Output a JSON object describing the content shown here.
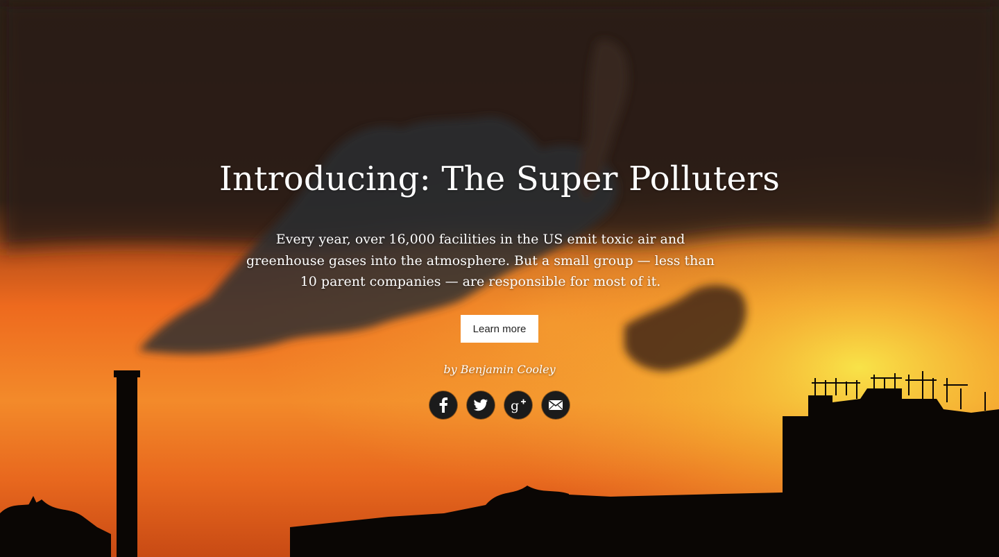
{
  "hero": {
    "title": "Introducing: The Super Polluters",
    "lede": "Every year, over 16,000 facilities in the US emit toxic air and greenhouse gases into the atmosphere. But a small group — less than 10 parent companies — are responsible for most of it.",
    "button_label": "Learn more",
    "byline": "by Benjamin Cooley"
  },
  "share": [
    {
      "icon": "facebook-icon"
    },
    {
      "icon": "twitter-icon"
    },
    {
      "icon": "google-plus-icon"
    },
    {
      "icon": "email-icon"
    }
  ],
  "colors": {
    "sky_dark": "#2a1c14",
    "sunset_orange": "#f06a1c",
    "sunset_yellow": "#f7c23a",
    "silhouette": "#0a0604",
    "icon_bg": "#1b1b1b"
  }
}
